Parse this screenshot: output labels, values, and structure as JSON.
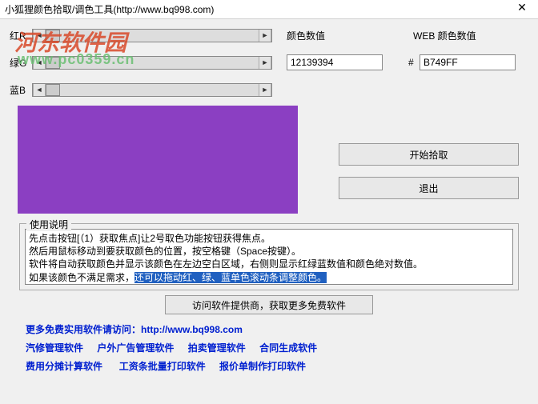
{
  "window": {
    "title": "小狐狸颜色拾取/调色工具(http://www.bq998.com)"
  },
  "watermark": {
    "line1": "河东软件园",
    "line2": "www.pc0359.cn"
  },
  "sliders": {
    "red": {
      "label": "红R",
      "thumbPct": 0
    },
    "green": {
      "label": "绿G",
      "thumbPct": 0
    },
    "blue": {
      "label": "蓝B",
      "thumbPct": 0
    }
  },
  "labels": {
    "colorValue": "颜色数值",
    "webColorValue": "WEB 颜色数值",
    "hash": "#"
  },
  "values": {
    "colorValue": "12139394",
    "webColor": "B749FF"
  },
  "preview": {
    "color": "#8b3fc2"
  },
  "buttons": {
    "startPick": "开始拾取",
    "exit": "退出",
    "visitVendor": "访问软件提供商，获取更多免费软件"
  },
  "instructions": {
    "legend": "使用说明",
    "line1": "先点击按钮[（1）获取焦点]让2号取色功能按钮获得焦点。",
    "line2": "然后用鼠标移动到要获取颜色的位置，按空格键（Space按键）。",
    "line3": "软件将自动获取颜色并显示该颜色在左边空白区域，右侧则显示红绿蓝数值和颜色绝对数值。",
    "line4a": "如果该颜色不满足需求，",
    "line4b": "还可以拖动红、绿、蓝单色滚动条调整颜色。"
  },
  "links": {
    "more": "更多免费实用软件请访问：",
    "url": "http://www.bq998.com",
    "row2": [
      "汽修管理软件",
      "户外广告管理软件",
      "拍卖管理软件",
      "合同生成软件"
    ],
    "row3": [
      "费用分摊计算软件",
      "工资条批量打印软件",
      "报价单制作打印软件"
    ]
  }
}
